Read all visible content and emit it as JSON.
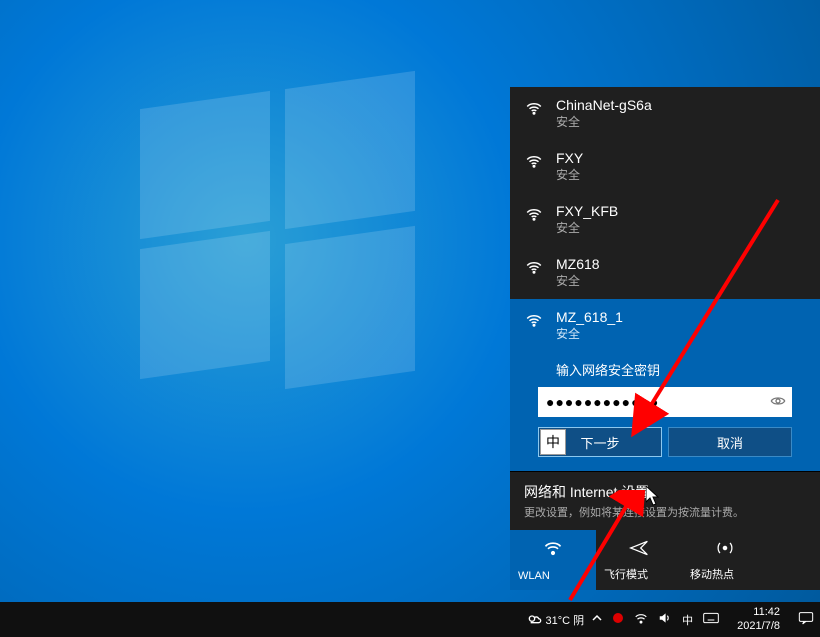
{
  "networks": [
    {
      "name": "ChinaNet-gS6a",
      "status": "安全"
    },
    {
      "name": "FXY",
      "status": "安全"
    },
    {
      "name": "FXY_KFB",
      "status": "安全"
    },
    {
      "name": "MZ618",
      "status": "安全"
    }
  ],
  "selected_network": {
    "name": "MZ_618_1",
    "status": "安全",
    "prompt": "输入网络安全密钥",
    "password_dots": "●●●●●●●●●●●●",
    "ime_badge": "中",
    "next_btn": "下一步",
    "cancel_btn": "取消"
  },
  "settings": {
    "title": "网络和 Internet 设置",
    "desc": "更改设置，例如将某连接设置为按流量计费。"
  },
  "tiles": {
    "wlan": "WLAN",
    "airplane": "飞行模式",
    "hotspot": "移动热点"
  },
  "taskbar": {
    "weather_temp": "31°C 阴",
    "ime_lang": "中",
    "time": "11:42",
    "date": "2021/7/8"
  }
}
